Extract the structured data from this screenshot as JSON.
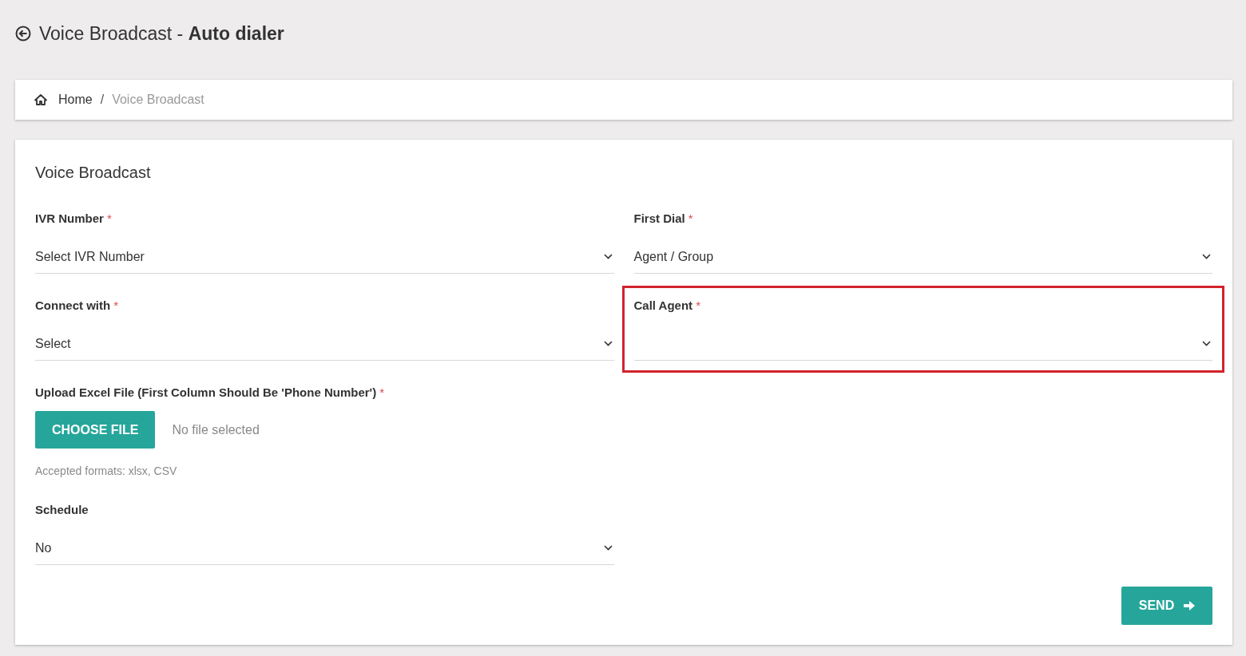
{
  "page": {
    "title": "Voice Broadcast - **Auto dialer**"
  },
  "breadcrumb": [
    {
      "label": "Home",
      "kind": "home"
    },
    {
      "label": "Voice Broadcast",
      "kind": "current"
    }
  ],
  "breadcrumb_separator": "/",
  "card": {
    "title": "Voice Broadcast"
  },
  "form": {
    "left": [
      {
        "kind": "select",
        "label": "IVR Number",
        "required_mark": "*",
        "value": "Select IVR Number",
        "highlighted": false
      },
      {
        "kind": "select",
        "label": "Connect with",
        "required_mark": "*",
        "value": "Select",
        "highlighted": false
      },
      {
        "kind": "file",
        "label": "Upload Excel File (First Column Should Be 'Phone Number')",
        "required_mark": "*",
        "button": "CHOOSE FILE",
        "status": "No file selected",
        "hint": "Accepted formats: xlsx, CSV",
        "highlighted": false
      },
      {
        "kind": "select",
        "label": "Schedule",
        "value": "No",
        "highlighted": false
      }
    ],
    "right": [
      {
        "kind": "select",
        "label": "First Dial",
        "required_mark": "*",
        "value": "Agent / Group",
        "highlighted": false
      },
      {
        "kind": "select",
        "label": "Call Agent",
        "required_mark": "*",
        "highlighted": true
      }
    ]
  },
  "send_button": {
    "label": "SEND"
  }
}
